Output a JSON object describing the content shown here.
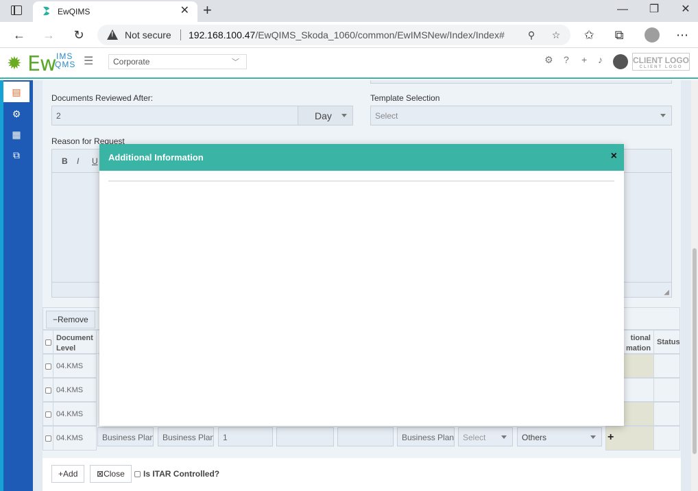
{
  "browser": {
    "tab_title": "EwQIMS",
    "security_label": "Not secure",
    "url_host": "192.168.100.47",
    "url_path": "/EwQIMS_Skoda_1060/common/EwIMSNew/Index/Index#"
  },
  "header": {
    "logo_text": "Ew",
    "logo_ims": "IMS",
    "logo_qms": "QMS",
    "org_select": "Corporate",
    "client_logo": "CLIENT LOGO",
    "client_logo_sub": "CLIENT LOGO"
  },
  "form": {
    "reviewed_after_label": "Documents Reviewed After:",
    "reviewed_after_value": "2",
    "period_unit": "Day",
    "template_label": "Template Selection",
    "template_placeholder": "Select",
    "reason_label": "Reason for Request"
  },
  "grid": {
    "remove_label": "Remove",
    "col_level": "Document Level",
    "col_addinfo": "tional mation",
    "col_status": "Status",
    "rows": [
      {
        "level": "04.KMS"
      },
      {
        "level": "04.KMS"
      },
      {
        "level": "04.KMS"
      },
      {
        "level": "04.KMS",
        "c1": "Business Plan",
        "c2": "Business Plan",
        "c3": "1",
        "c4": "",
        "c5": "",
        "c6": "Business Plan",
        "sel1": "Select",
        "sel2": "Others"
      }
    ]
  },
  "footer": {
    "add_label": "Add",
    "close_label": "Close",
    "itar_label": "Is ITAR Controlled?"
  },
  "modal": {
    "title": "Additional Information",
    "close_glyph": "×"
  }
}
